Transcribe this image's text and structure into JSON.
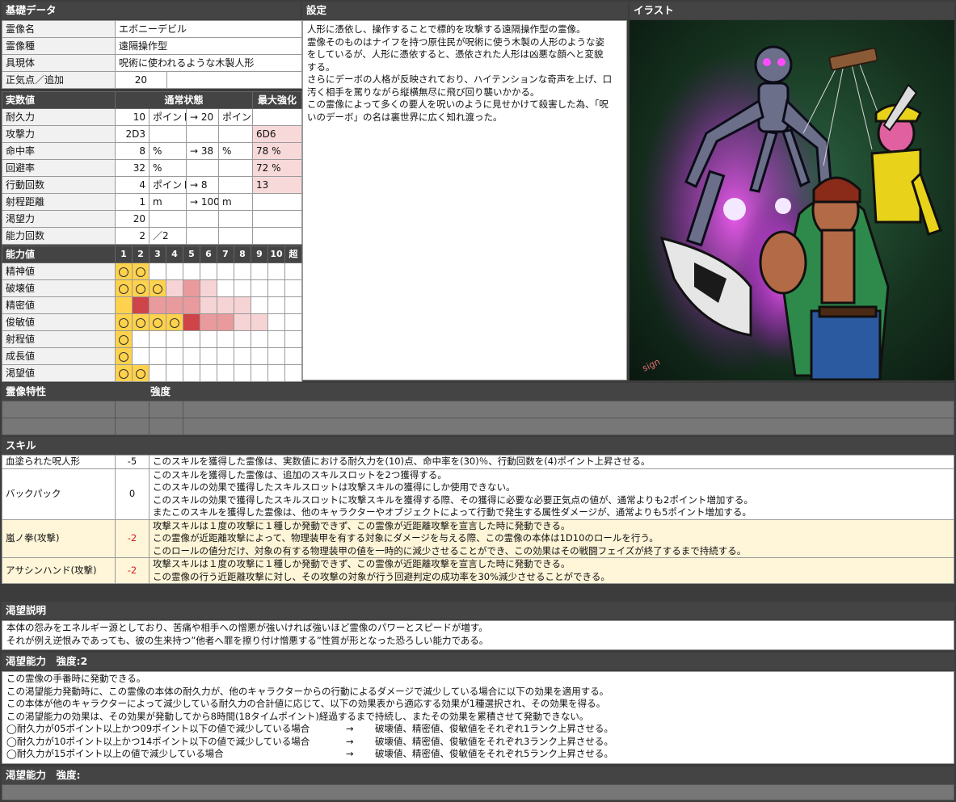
{
  "basic": {
    "title": "基礎データ",
    "rows": [
      {
        "label": "霊像名",
        "value": "エボニーデビル"
      },
      {
        "label": "霊像種",
        "value": "遠隔操作型"
      },
      {
        "label": "具現体",
        "value": "呪術に使われるような木製人形"
      }
    ],
    "sanity": {
      "label": "正気点／追加",
      "value": "20"
    }
  },
  "stats": {
    "title": "実数値",
    "col_normal": "通常状態",
    "col_max": "最大強化",
    "rows": [
      {
        "label": "耐久力",
        "v1": "10",
        "u1": "ポイント",
        "v2": "→ 20",
        "u2": "ポイント",
        "max": ""
      },
      {
        "label": "攻撃力",
        "v1": "2D3",
        "u1": "",
        "v2": "",
        "u2": "",
        "max": "6D6"
      },
      {
        "label": "命中率",
        "v1": "8",
        "u1": "%",
        "v2": "→ 38",
        "u2": "%",
        "max": "78 %"
      },
      {
        "label": "回避率",
        "v1": "32",
        "u1": "%",
        "v2": "",
        "u2": "",
        "max": "72 %"
      },
      {
        "label": "行動回数",
        "v1": "4",
        "u1": "ポイント",
        "v2": "→ 8",
        "u2": "",
        "max": "13"
      },
      {
        "label": "射程距離",
        "v1": "1",
        "u1": "m",
        "v2": "→ 100",
        "u2": "m",
        "max": ""
      },
      {
        "label": "渇望力",
        "v1": "20",
        "u1": "",
        "v2": "",
        "u2": "",
        "max": ""
      },
      {
        "label": "能力回数",
        "v1": "2",
        "u1": "／2",
        "v2": "",
        "u2": "",
        "max": ""
      }
    ]
  },
  "abilities": {
    "title": "能力値",
    "columns": [
      "1",
      "2",
      "3",
      "4",
      "5",
      "6",
      "7",
      "8",
      "9",
      "10",
      "超"
    ],
    "rows": [
      {
        "label": "精神値",
        "cells": [
          "go",
          "go",
          "",
          "",
          "",
          "",
          "",
          "",
          "",
          "",
          ""
        ]
      },
      {
        "label": "破壊値",
        "cells": [
          "go",
          "go",
          "go",
          "l",
          "m",
          "l",
          "",
          "",
          "",
          "",
          ""
        ]
      },
      {
        "label": "精密値",
        "cells": [
          "g",
          "d",
          "m",
          "m",
          "m",
          "l",
          "l",
          "l",
          "",
          "",
          ""
        ]
      },
      {
        "label": "俊敏値",
        "cells": [
          "go",
          "go",
          "go",
          "go",
          "d",
          "m",
          "m",
          "l",
          "l",
          "",
          ""
        ]
      },
      {
        "label": "射程値",
        "cells": [
          "go",
          "",
          "",
          "",
          "",
          "",
          "",
          "",
          "",
          "",
          ""
        ]
      },
      {
        "label": "成長値",
        "cells": [
          "go",
          "",
          "",
          "",
          "",
          "",
          "",
          "",
          "",
          "",
          ""
        ]
      },
      {
        "label": "渇望値",
        "cells": [
          "go",
          "go",
          "",
          "",
          "",
          "",
          "",
          "",
          "",
          "",
          ""
        ]
      }
    ]
  },
  "setting": {
    "title": "設定",
    "lines": [
      "人形に憑依し、操作することで標的を攻撃する遠隔操作型の霊像。",
      "霊像そのものはナイフを持つ原住民が呪術に使う木製の人形のような姿",
      "をしているが、人形に憑依すると、憑依された人形は凶悪な顔へと変貌",
      "する。",
      "さらにデーボの人格が反映されており、ハイテンションな奇声を上げ、口",
      "汚く相手を罵りながら縦横無尽に飛び回り襲いかかる。",
      "この霊像によって多くの要人を呪いのように見せかけて殺害した為、「呪",
      "いのデーボ」の名は裏世界に広く知れ渡った。"
    ]
  },
  "illustration": {
    "title": "イラスト"
  },
  "traits": {
    "title": "霊像特性",
    "strength": "強度"
  },
  "skills": {
    "title": "スキル",
    "items": [
      {
        "name": "血塗られた呪人形",
        "cost": "-5",
        "cost_color": "#111111",
        "lines": [
          "このスキルを獲得した霊像は、実数値における耐久力を(10)点、命中率を(30)％、行動回数を(4)ポイント上昇させる。"
        ]
      },
      {
        "name": "バックパック",
        "cost": "0",
        "cost_color": "#111111",
        "lines": [
          "このスキルを獲得した霊像は、追加のスキルスロットを2つ獲得する。",
          "このスキルの効果で獲得したスキルスロットは攻撃スキルの獲得にしか使用できない。",
          "このスキルの効果で獲得したスキルスロットに攻撃スキルを獲得する際、その獲得に必要な必要正気点の値が、通常よりも2ポイント増加する。",
          "またこのスキルを獲得した霊像は、他のキャラクターやオブジェクトによって行動で発生する属性ダメージが、通常よりも5ポイント増加する。"
        ]
      },
      {
        "name": "嵐ノ拳(攻撃)",
        "cost": "-2",
        "cost_color": "#d42020",
        "lines": [
          "攻撃スキルは１度の攻撃に１種しか発動できず、この霊像が近距離攻撃を宣言した時に発動できる。",
          "この霊像が近距離攻撃によって、物理装甲を有する対象にダメージを与える際、この霊像の本体は1D10のロールを行う。",
          "このロールの値分だけ、対象の有する物理装甲の値を一時的に減少させることができ、この効果はその戦闘フェイズが終了するまで持続する。"
        ]
      },
      {
        "name": "アサシンハンド(攻撃)",
        "cost": "-2",
        "cost_color": "#d42020",
        "lines": [
          "攻撃スキルは１度の攻撃に１種しか発動できず、この霊像が近距離攻撃を宣言した時に発動できる。",
          "この霊像の行う近距離攻撃に対し、その攻撃の対象が行う回避判定の成功率を30%減少させることができる。"
        ]
      }
    ]
  },
  "craving_desc": {
    "title": "渇望説明",
    "lines": [
      "本体の怨みをエネルギー源としており、苦痛や相手への憎悪が強いければ強いほど霊像のパワーとスピードが増す。",
      "それが例え逆恨みであっても、彼の生来持つ”他者へ罪を擦り付け憎悪する”性質が形となった恐ろしい能力である。"
    ]
  },
  "craving_ability": {
    "title": "渇望能力　強度:2",
    "lines": [
      "この霊像の手番時に発動できる。",
      "この渇望能力発動時に、この霊像の本体の耐久力が、他のキャラクターからの行動によるダメージで減少している場合に以下の効果を適用する。",
      "この本体が他のキャラクターによって減少している耐久力の合計値に応じて、以下の効果表から適応する効果が1種選択され、その効果を得る。",
      "この渇望能力の効果は、その効果が発動してから8時間(18タイムポイント)経過するまで持続し、またその効果を累積させて発動できない。"
    ],
    "effects": [
      {
        "cond": "◯耐久力が05ポイント以上かつ09ポイント以下の値で減少している場合",
        "arrow": "→",
        "result": "破壊値、精密値、俊敏値をそれぞれ1ランク上昇させる。"
      },
      {
        "cond": "◯耐久力が10ポイント以上かつ14ポイント以下の値で減少している場合",
        "arrow": "→",
        "result": "破壊値、精密値、俊敏値をそれぞれ3ランク上昇させる。"
      },
      {
        "cond": "◯耐久力が15ポイント以上の値で減少している場合",
        "arrow": "→",
        "result": "破壊値、精密値、俊敏値をそれぞれ5ランク上昇させる。"
      }
    ]
  },
  "craving_ability2": {
    "title": "渇望能力　強度:"
  }
}
